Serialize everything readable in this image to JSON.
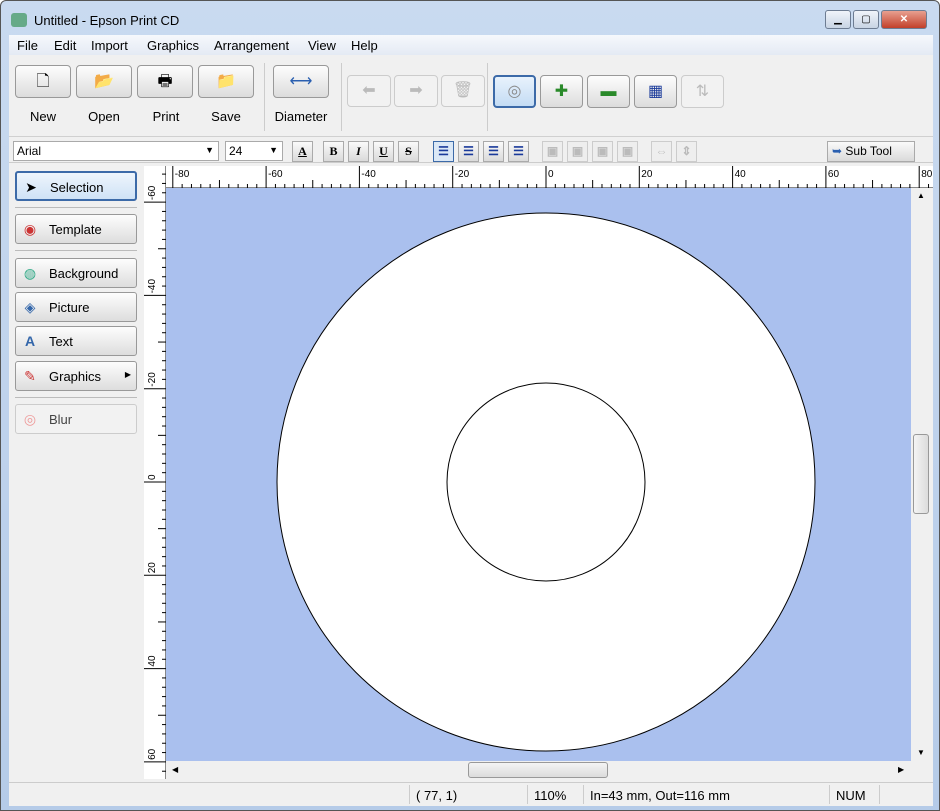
{
  "window": {
    "title": "Untitled - Epson Print CD"
  },
  "menu": [
    "File",
    "Edit",
    "Import",
    "Graphics",
    "Arrangement",
    "View",
    "Help"
  ],
  "toolbar": {
    "new": "New",
    "open": "Open",
    "print": "Print",
    "save": "Save",
    "diameter": "Diameter"
  },
  "format": {
    "font": "Arial",
    "size": "24",
    "bold": "B",
    "italic": "I",
    "underline": "U",
    "strike": "S",
    "sub_tool": "Sub Tool"
  },
  "tools": {
    "selection": "Selection",
    "template": "Template",
    "background": "Background",
    "picture": "Picture",
    "text": "Text",
    "graphics": "Graphics",
    "blur": "Blur"
  },
  "ruler": {
    "h": [
      "-80",
      "-60",
      "-40",
      "-20",
      "0",
      "20",
      "40",
      "60",
      "80"
    ],
    "v": [
      "-60",
      "-40",
      "-20",
      "0",
      "20",
      "40",
      "60"
    ]
  },
  "status": {
    "coords": "( 77,  1)",
    "zoom": "110%",
    "diameter": "In=43 mm, Out=116 mm",
    "num": "NUM"
  },
  "colors": {
    "canvas": "#aac0ee",
    "accent": "#3c6aa8"
  }
}
